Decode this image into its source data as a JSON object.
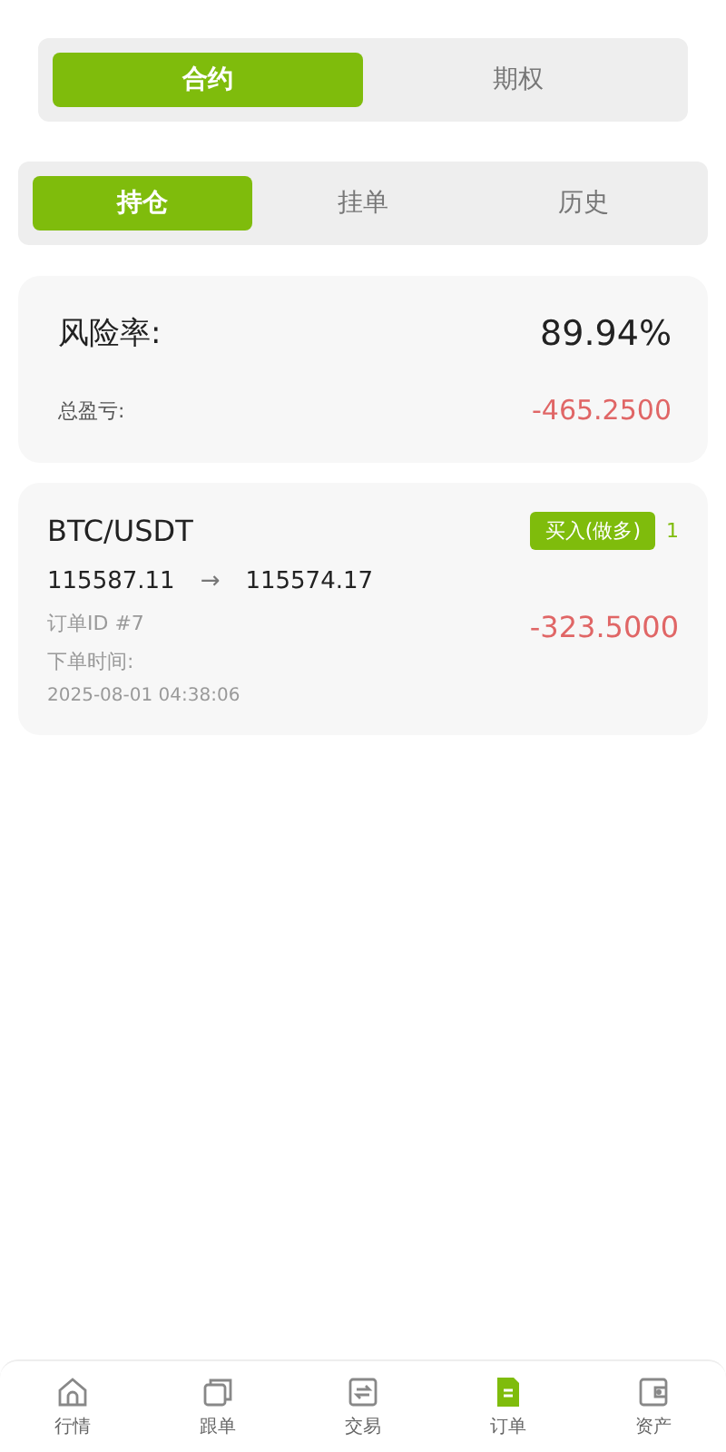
{
  "top_tabs": [
    {
      "label": "合约",
      "selected": true
    },
    {
      "label": "期权",
      "selected": false
    }
  ],
  "order_tabs": [
    {
      "label": "持仓",
      "selected": true
    },
    {
      "label": "挂单",
      "selected": false
    },
    {
      "label": "历史",
      "selected": false
    }
  ],
  "summary": {
    "risk_label": "风险率:",
    "risk_value": "89.94%",
    "pnl_label": "总盈亏:",
    "pnl_value": "-465.2500"
  },
  "positions": [
    {
      "symbol": "BTC/USDT",
      "side": "买入(做多)",
      "leverage": "1",
      "open_price": "115587.11",
      "arrow": "→",
      "current_price": "115574.17",
      "order_id": "订单ID #7",
      "time_label": "下单时间:",
      "time": "2025-08-01 04:38:06",
      "pnl": "-323.5000"
    }
  ],
  "nav": [
    {
      "label": "行情",
      "selected": false
    },
    {
      "label": "跟单",
      "selected": false
    },
    {
      "label": "交易",
      "selected": false
    },
    {
      "label": "订单",
      "selected": true
    },
    {
      "label": "资产",
      "selected": false
    }
  ]
}
